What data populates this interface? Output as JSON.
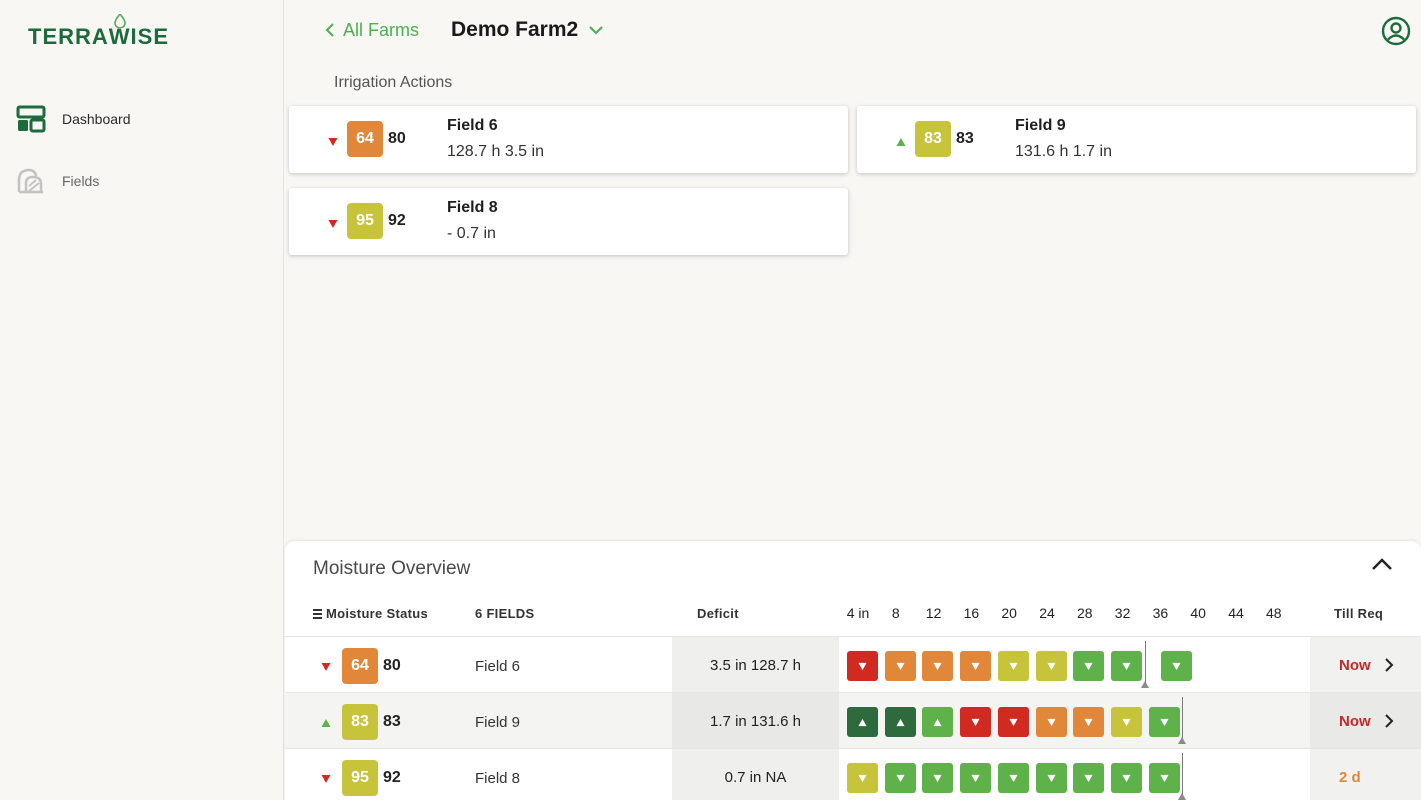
{
  "colors": {
    "accent": "#4caf50",
    "brand": "#1d6b3a",
    "red": "#d02a21",
    "orange": "#e0873a",
    "yellow": "#c7c33a",
    "green": "#5fb14a",
    "dark_green": "#2e6b3c",
    "trend_down": "#d02a21",
    "trend_up": "#5fb14a",
    "till_now": "#c62828",
    "till_later": "#e0873a"
  },
  "sidebar": {
    "logo_text_left": "TERRA",
    "logo_text_w": "W",
    "logo_text_right": "ISE",
    "items": [
      {
        "label": "Dashboard",
        "icon": "dashboard-icon",
        "active": true
      },
      {
        "label": "Fields",
        "icon": "fields-icon",
        "active": false
      }
    ]
  },
  "header": {
    "back_label": "All Farms",
    "farm_name": "Demo Farm2",
    "profile_icon": "account-circle-icon"
  },
  "irrigation": {
    "title": "Irrigation Actions",
    "cards": [
      {
        "field": "Field 6",
        "score": "64",
        "score_color": "orange",
        "trend": "down",
        "target": "80",
        "detail": "128.7 h 3.5 in"
      },
      {
        "field": "Field 9",
        "score": "83",
        "score_color": "yellow",
        "trend": "up",
        "target": "83",
        "detail": "131.6 h 1.7 in"
      },
      {
        "field": "Field 8",
        "score": "95",
        "score_color": "yellow",
        "trend": "down",
        "target": "92",
        "detail": "-  0.7 in"
      }
    ]
  },
  "moisture": {
    "title": "Moisture Overview",
    "headers": {
      "status": "Moisture Status",
      "fields": "6 FIELDS",
      "deficit": "Deficit",
      "till": "Till Req"
    },
    "depths": [
      "4 in",
      "8",
      "12",
      "16",
      "20",
      "24",
      "28",
      "32",
      "36",
      "40",
      "44",
      "48"
    ],
    "rows": [
      {
        "score": "64",
        "score_color": "orange",
        "trend": "down",
        "target": "80",
        "field": "Field 6",
        "deficit_value": "3.5",
        "deficit_unit": "in",
        "deficit_hours": "128.7 h",
        "cells": [
          {
            "c": "red",
            "d": "down"
          },
          {
            "c": "orange",
            "d": "down"
          },
          {
            "c": "orange",
            "d": "down"
          },
          {
            "c": "orange",
            "d": "down"
          },
          {
            "c": "yellow",
            "d": "down"
          },
          {
            "c": "yellow",
            "d": "down"
          },
          {
            "c": "green",
            "d": "down"
          },
          {
            "c": "green",
            "d": "down"
          },
          {
            "c": "green",
            "d": "down"
          }
        ],
        "root_depth_in": 37,
        "till": "Now",
        "till_color": "till_now",
        "has_chevron": true
      },
      {
        "score": "83",
        "score_color": "yellow",
        "trend": "up",
        "target": "83",
        "field": "Field 9",
        "deficit_value": "1.7",
        "deficit_unit": "in",
        "deficit_hours": "131.6 h",
        "cells": [
          {
            "c": "dark_green",
            "d": "up"
          },
          {
            "c": "dark_green",
            "d": "up"
          },
          {
            "c": "green",
            "d": "up"
          },
          {
            "c": "red",
            "d": "down"
          },
          {
            "c": "red",
            "d": "down"
          },
          {
            "c": "orange",
            "d": "down"
          },
          {
            "c": "orange",
            "d": "down"
          },
          {
            "c": "yellow",
            "d": "down"
          },
          {
            "c": "green",
            "d": "down"
          }
        ],
        "root_depth_in": 37,
        "till": "Now",
        "till_color": "till_now",
        "has_chevron": true
      },
      {
        "score": "95",
        "score_color": "yellow",
        "trend": "down",
        "target": "92",
        "field": "Field 8",
        "deficit_value": "0.7",
        "deficit_unit": "in",
        "deficit_hours": "NA",
        "cells": [
          {
            "c": "yellow",
            "d": "down"
          },
          {
            "c": "green",
            "d": "down"
          },
          {
            "c": "green",
            "d": "down"
          },
          {
            "c": "green",
            "d": "down"
          },
          {
            "c": "green",
            "d": "down"
          },
          {
            "c": "green",
            "d": "down"
          },
          {
            "c": "green",
            "d": "down"
          },
          {
            "c": "green",
            "d": "down"
          },
          {
            "c": "green",
            "d": "down"
          }
        ],
        "root_depth_in": 37,
        "till": "2 d",
        "till_color": "till_later",
        "has_chevron": false
      }
    ]
  }
}
